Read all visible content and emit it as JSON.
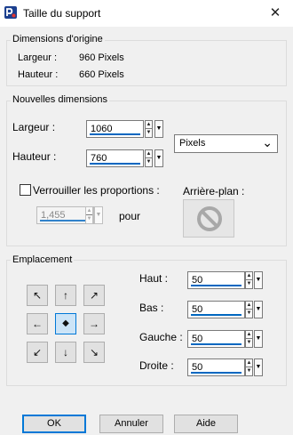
{
  "window": {
    "title": "Taille du support",
    "close_glyph": "✕"
  },
  "original": {
    "group_title": "Dimensions d'origine",
    "width_label": "Largeur :",
    "width_value": "960 Pixels",
    "height_label": "Hauteur :",
    "height_value": "660 Pixels"
  },
  "new_dims": {
    "group_title": "Nouvelles dimensions",
    "width_label": "Largeur :",
    "width_value": "1060",
    "height_label": "Hauteur :",
    "height_value": "760",
    "unit_selected": "Pixels",
    "lock_label": "Verrouiller les proportions :",
    "lock_checked": false,
    "ratio_value": "1,455",
    "ratio_unit": "pour",
    "background_label": "Arrière-plan :"
  },
  "placement": {
    "group_title": "Emplacement",
    "anchor_selected": "center",
    "top_label": "Haut :",
    "top_value": "50",
    "bottom_label": "Bas :",
    "bottom_value": "50",
    "left_label": "Gauche :",
    "left_value": "50",
    "right_label": "Droite :",
    "right_value": "50"
  },
  "icons": {
    "arrow_nw": "↖",
    "arrow_n": "↑",
    "arrow_ne": "↗",
    "arrow_w": "←",
    "center": "◆",
    "arrow_e": "→",
    "arrow_sw": "↙",
    "arrow_s": "↓",
    "arrow_se": "↘",
    "spin_up": "▲",
    "spin_down": "▼",
    "dropdown": "▼",
    "select_chevron": "⌄"
  },
  "buttons": {
    "ok": "OK",
    "cancel": "Annuler",
    "help": "Aide"
  },
  "colors": {
    "accent": "#0067c0",
    "button_default_border": "#0078d7",
    "background": "#f0f0f0"
  }
}
